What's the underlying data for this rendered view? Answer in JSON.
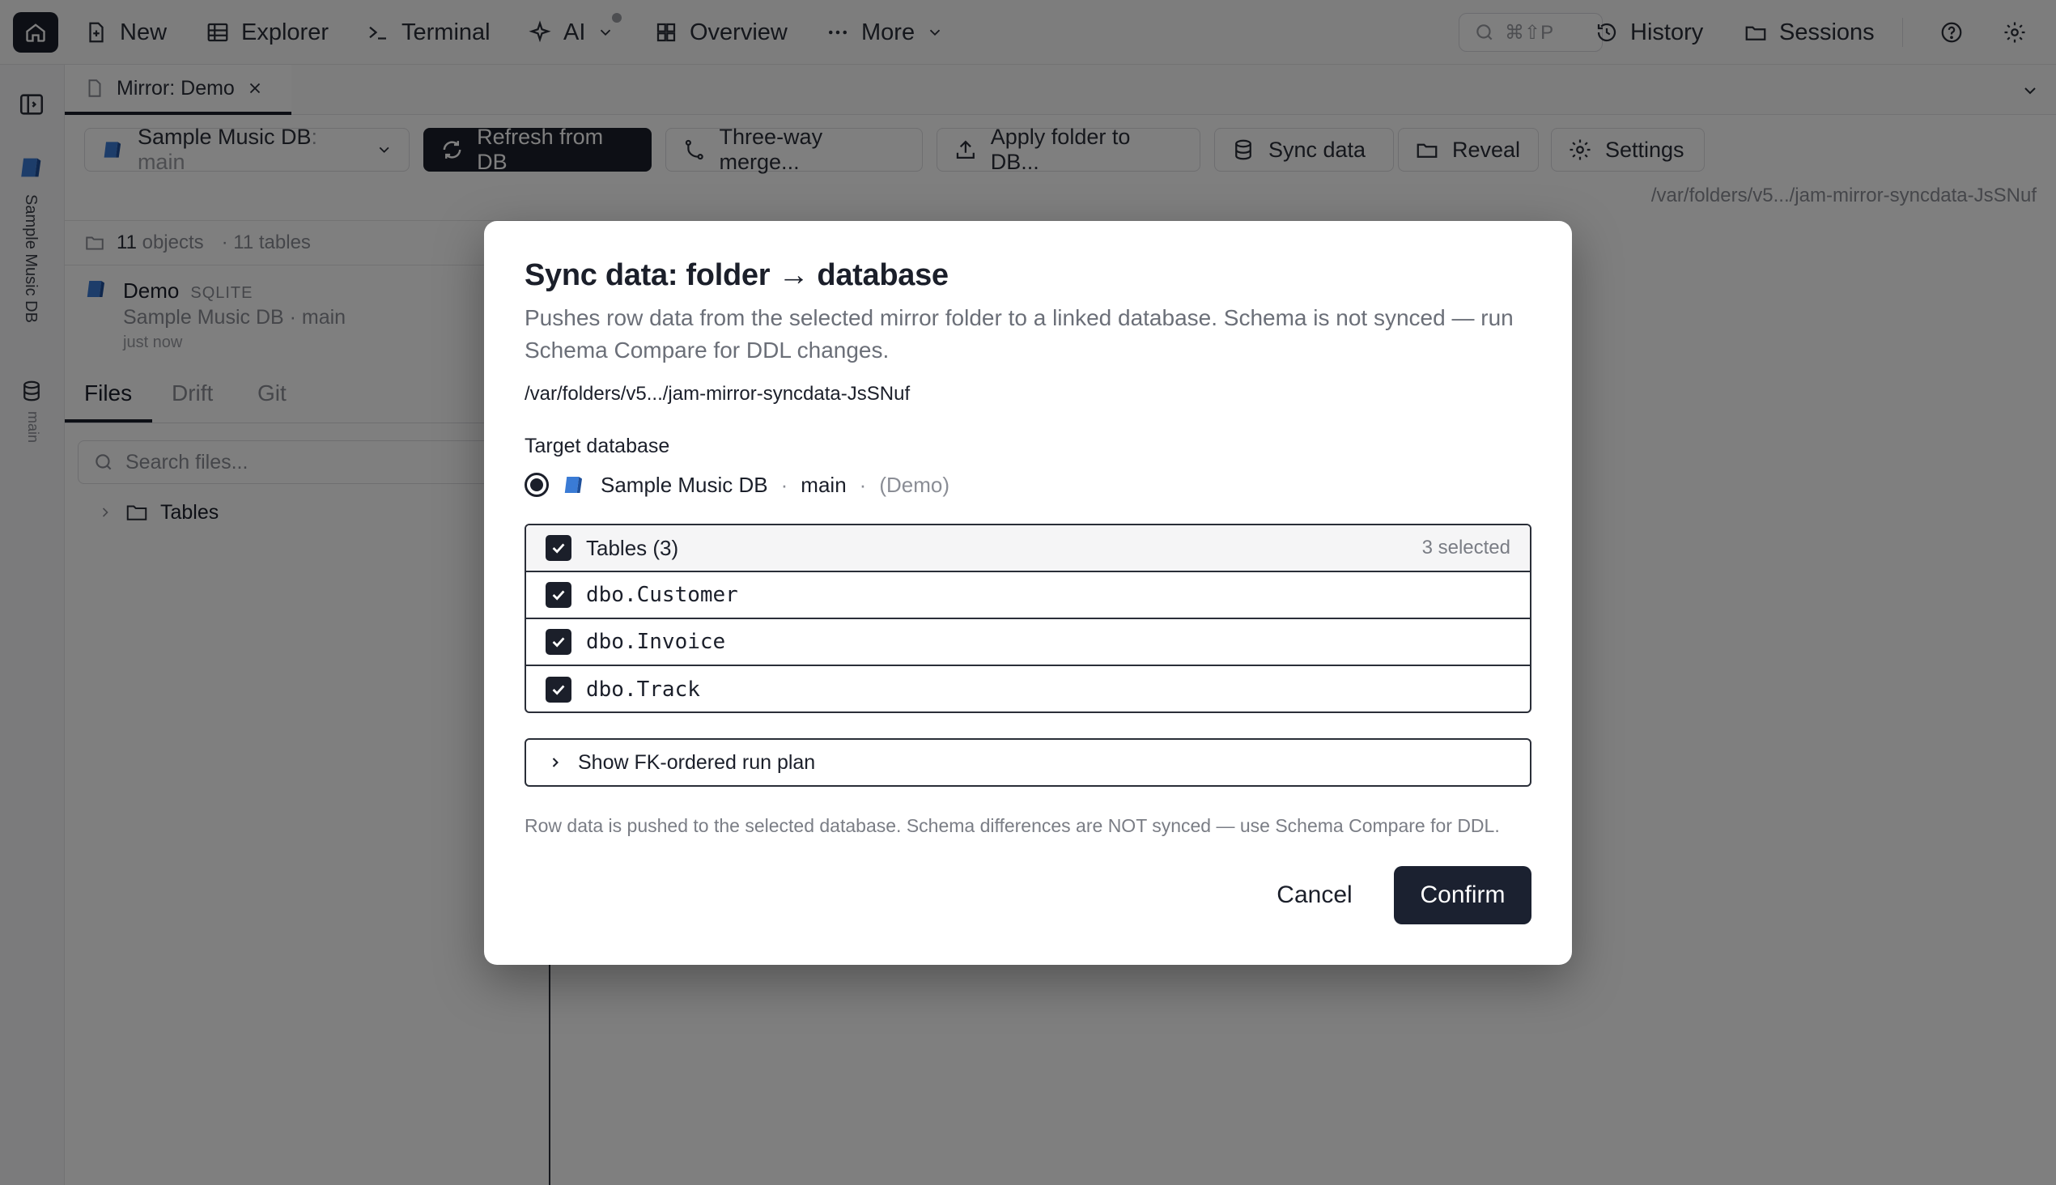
{
  "topbar": {
    "new": "New",
    "explorer": "Explorer",
    "terminal": "Terminal",
    "ai": "AI",
    "overview": "Overview",
    "more": "More",
    "search_shortcut": "⌘⇧P",
    "history": "History",
    "sessions": "Sessions"
  },
  "rail": {
    "db_label": "Sample Music DB",
    "branch_label": "main"
  },
  "tab": {
    "title": "Mirror: Demo"
  },
  "toolbar": {
    "db_name": "Sample Music DB",
    "db_branch": ": main",
    "refresh": "Refresh from DB",
    "merge": "Three-way merge...",
    "apply": "Apply folder to DB...",
    "sync": "Sync data",
    "reveal": "Reveal",
    "settings": "Settings",
    "path": "/var/folders/v5.../jam-mirror-syncdata-JsSNuf"
  },
  "leftpanel": {
    "objects_count": "11",
    "objects_label": "objects",
    "tables_label": "· 11 tables",
    "mirror_name": "Demo",
    "mirror_engine": "SQLITE",
    "mirror_sub": "Sample Music DB · main",
    "mirror_time": "just now",
    "tabs": [
      "Files",
      "Drift",
      "Git"
    ],
    "search_placeholder": "Search files...",
    "tree_folder": "Tables"
  },
  "dialog": {
    "title": "Sync data: folder → database",
    "description": "Pushes row data from the selected mirror folder to a linked database. Schema is not synced — run Schema Compare for DDL changes.",
    "path": "/var/folders/v5.../jam-mirror-syncdata-JsSNuf",
    "target_label": "Target database",
    "target_db": "Sample Music DB",
    "target_sep": "·",
    "target_branch": "main",
    "target_mirror": "(Demo)",
    "tables_header": "Tables (3)",
    "selected_count": "3 selected",
    "tables": [
      "dbo.Customer",
      "dbo.Invoice",
      "dbo.Track"
    ],
    "fk_plan": "Show FK-ordered run plan",
    "note": "Row data is pushed to the selected database. Schema differences are NOT synced — use Schema Compare for DDL.",
    "cancel": "Cancel",
    "confirm": "Confirm"
  },
  "colors": {
    "dark": "#1b1f2a",
    "muted": "#6b6f78",
    "db_icon_blue": "#3a7bd5"
  }
}
